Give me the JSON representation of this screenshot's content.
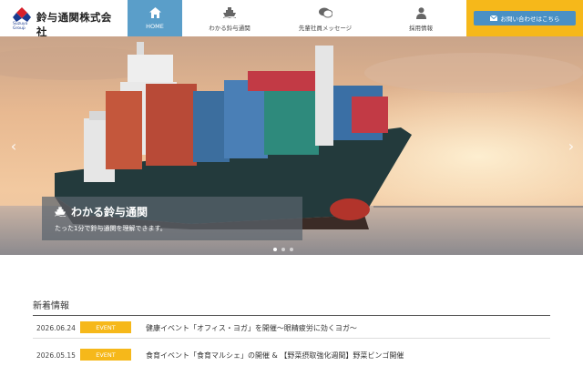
{
  "brand": {
    "name": "鈴与通関株式会社",
    "sub": "Suzuyo Group"
  },
  "nav": {
    "items": [
      {
        "label": "HOME",
        "icon": "home-icon"
      },
      {
        "label": "わかる鈴与通関",
        "icon": "ship-icon"
      },
      {
        "label": "先輩社員メッセージ",
        "icon": "chat-icon"
      },
      {
        "label": "採用情報",
        "icon": "person-icon"
      }
    ],
    "contact_label": "お問い合わせはこちら",
    "active_color": "#5a9ec9",
    "accent_color": "#f6b81a"
  },
  "hero": {
    "caption_title": "わかる鈴与通関",
    "caption_sub": "たった1分で鈴与通関を理解できます。",
    "prev_label": "‹",
    "next_label": "›"
  },
  "news": {
    "heading": "新着情報",
    "items": [
      {
        "date": "2026.06.24",
        "tag": "EVENT",
        "title": "健康イベント「オフィス・ヨガ」を開催～眼精疲労に効くヨガ～"
      },
      {
        "date": "2026.05.15",
        "tag": "EVENT",
        "title": "食育イベント「食育マルシェ」の開催 & 【野菜摂取強化週間】野菜ビンゴ開催"
      }
    ]
  }
}
